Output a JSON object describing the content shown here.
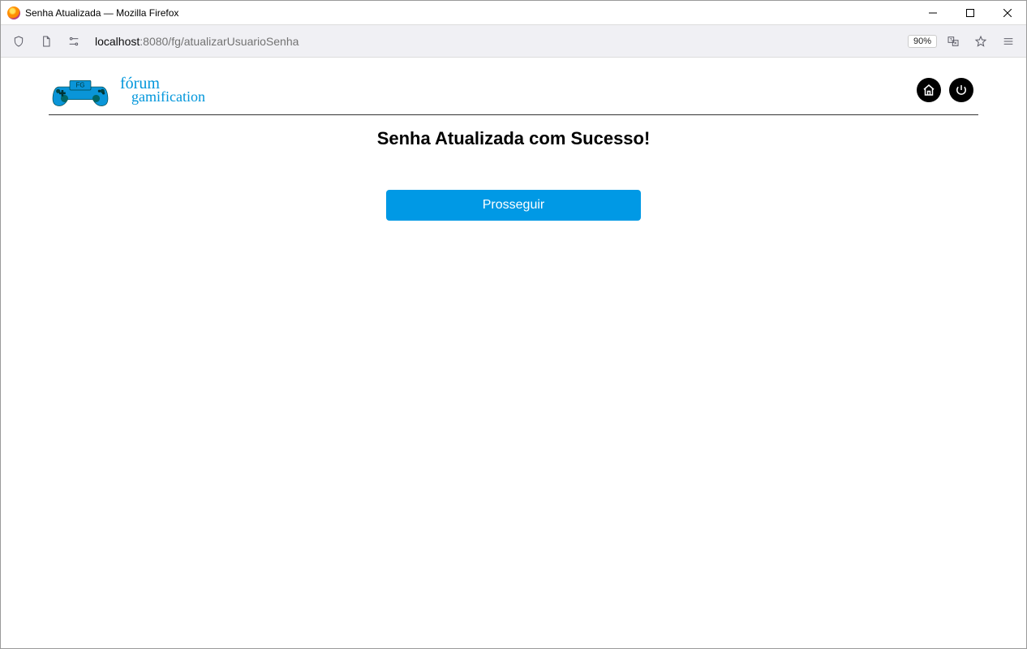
{
  "window": {
    "title": "Senha Atualizada — Mozilla Firefox"
  },
  "addressbar": {
    "host": "localhost",
    "rest": ":8080/fg/atualizarUsuarioSenha",
    "zoom": "90%"
  },
  "site": {
    "logo_line1": "fórum",
    "logo_line2": "gamification",
    "logo_badge": "FG"
  },
  "content": {
    "heading": "Senha Atualizada com Sucesso!",
    "proceed_label": "Prosseguir"
  },
  "icons": {
    "home": "home-icon",
    "power": "power-icon"
  }
}
